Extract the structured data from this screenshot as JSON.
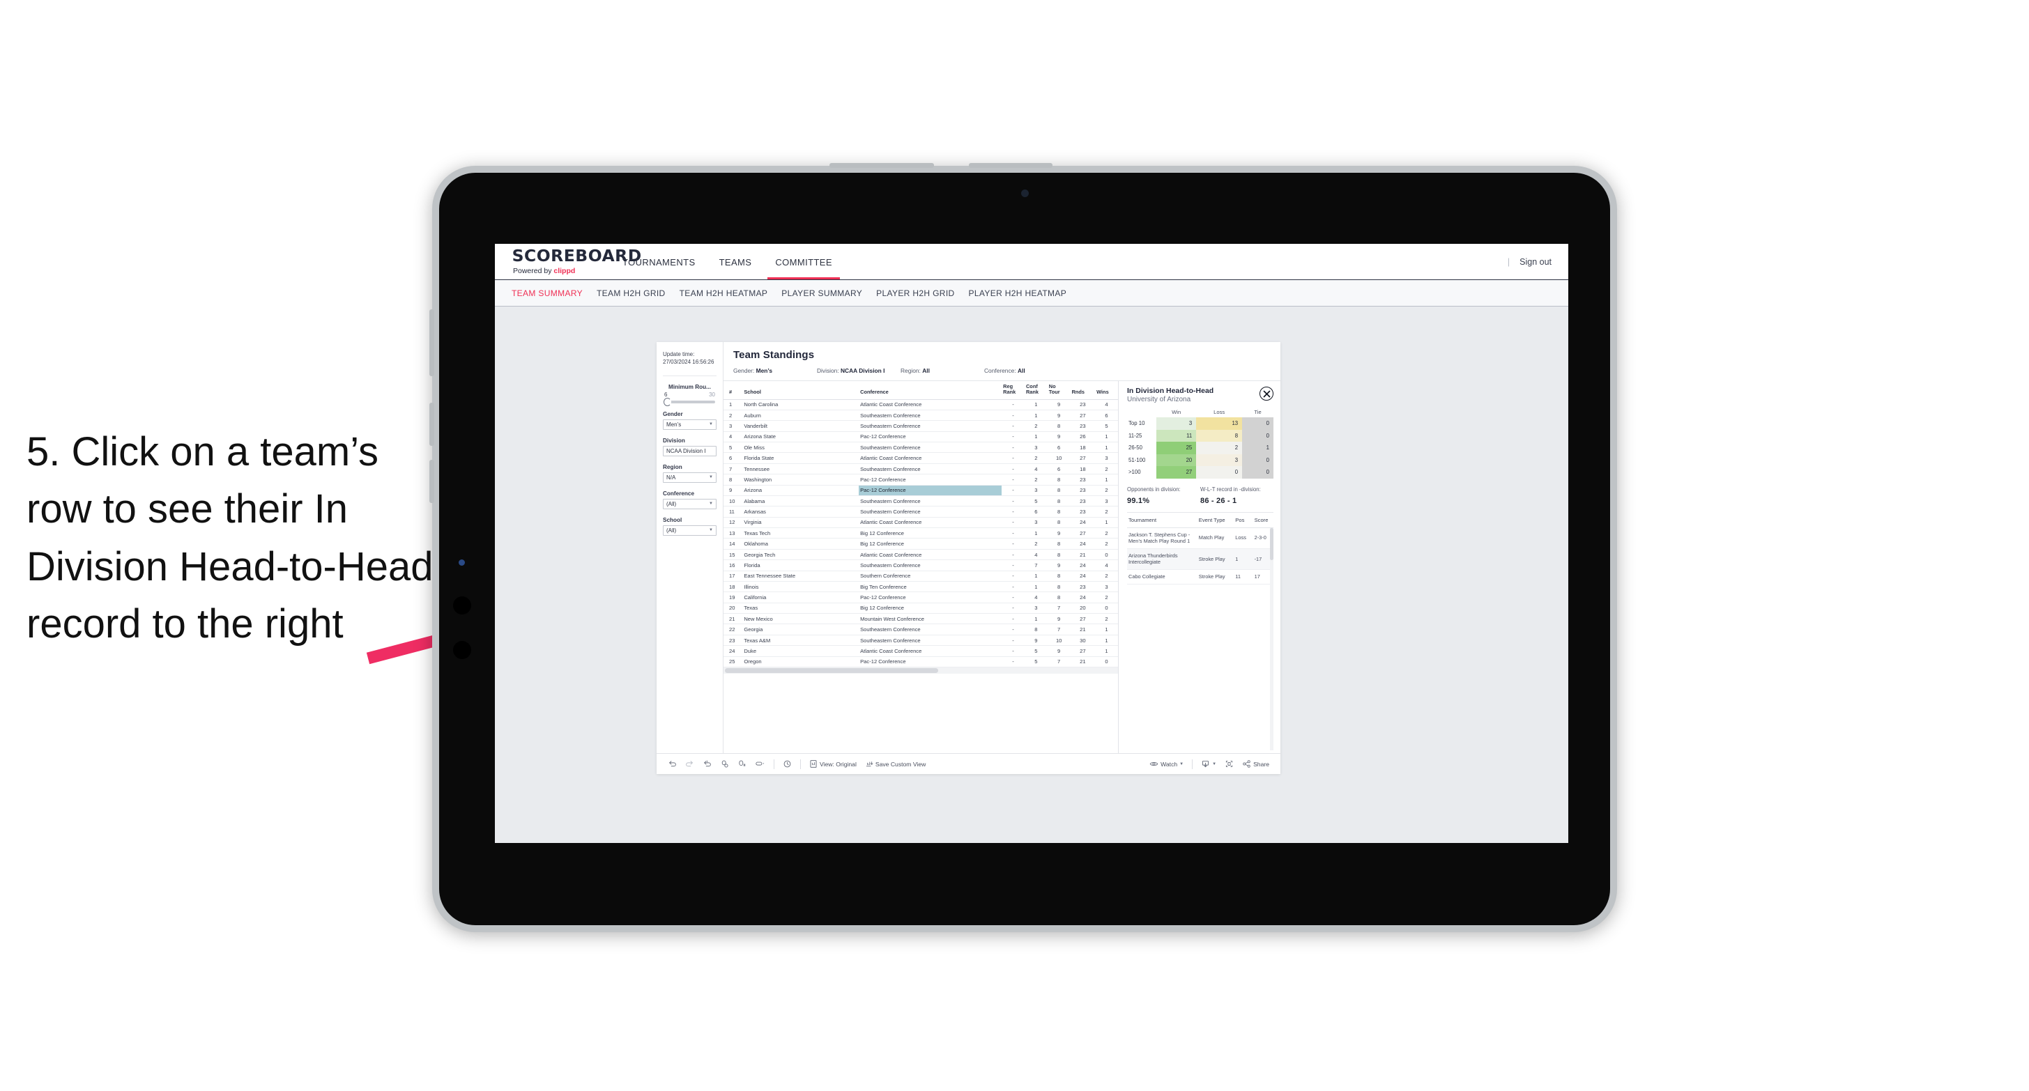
{
  "annotation": {
    "text": "5. Click on a team’s row to see their In Division Head-to-Head record to the right",
    "arrow_color": "#ef2d63"
  },
  "app": {
    "logo_main": "SCOREBOARD",
    "logo_sub_prefix": "Powered by ",
    "logo_sub_brand": "clippd",
    "top_nav": [
      {
        "label": "TOURNAMENTS",
        "active": false
      },
      {
        "label": "TEAMS",
        "active": false
      },
      {
        "label": "COMMITTEE",
        "active": true
      }
    ],
    "sign_out": "Sign out",
    "divider": "|",
    "sub_nav": [
      {
        "label": "TEAM SUMMARY",
        "active": true
      },
      {
        "label": "TEAM H2H GRID",
        "active": false
      },
      {
        "label": "TEAM H2H HEATMAP",
        "active": false
      },
      {
        "label": "PLAYER SUMMARY",
        "active": false
      },
      {
        "label": "PLAYER H2H GRID",
        "active": false
      },
      {
        "label": "PLAYER H2H HEATMAP",
        "active": false
      }
    ],
    "accent_color": "#ef2f54"
  },
  "filters": {
    "update_time_label": "Update time:",
    "update_time_value": "27/03/2024 16:56:26",
    "slider": {
      "title": "Minimum Rou...",
      "min": "6",
      "max": "30"
    },
    "groups": [
      {
        "label": "Gender",
        "value": "Men’s"
      },
      {
        "label": "Division",
        "value": "NCAA Division I"
      },
      {
        "label": "Region",
        "value": "N/A"
      },
      {
        "label": "Conference",
        "value": "(All)"
      },
      {
        "label": "School",
        "value": "(All)"
      }
    ]
  },
  "standings": {
    "title": "Team Standings",
    "meta": [
      {
        "label": "Gender:",
        "value": "Men’s"
      },
      {
        "label": "Division:",
        "value": "NCAA Division I"
      },
      {
        "label": "Region:",
        "value": "All"
      },
      {
        "label": "Conference:",
        "value": "All"
      }
    ],
    "columns": [
      "#",
      "School",
      "Conference",
      "Reg Rank",
      "Conf Rank",
      "No Tour",
      "Rnds",
      "Wins"
    ],
    "column_lines": [
      [
        "#",
        ""
      ],
      [
        "School",
        ""
      ],
      [
        "Conference",
        ""
      ],
      [
        "Reg",
        "Rank"
      ],
      [
        "Conf",
        "Rank"
      ],
      [
        "No",
        "Tour"
      ],
      [
        "",
        "Rnds"
      ],
      [
        "",
        "Wins"
      ]
    ],
    "selected_row_index": 8,
    "rows": [
      {
        "rank": "1",
        "school": "North Carolina",
        "conference": "Atlantic Coast Conference",
        "reg_rank": "-",
        "conf_rank": "1",
        "no_tour": "9",
        "rnds": "23",
        "wins": "4"
      },
      {
        "rank": "2",
        "school": "Auburn",
        "conference": "Southeastern Conference",
        "reg_rank": "-",
        "conf_rank": "1",
        "no_tour": "9",
        "rnds": "27",
        "wins": "6"
      },
      {
        "rank": "3",
        "school": "Vanderbilt",
        "conference": "Southeastern Conference",
        "reg_rank": "-",
        "conf_rank": "2",
        "no_tour": "8",
        "rnds": "23",
        "wins": "5"
      },
      {
        "rank": "4",
        "school": "Arizona State",
        "conference": "Pac-12 Conference",
        "reg_rank": "-",
        "conf_rank": "1",
        "no_tour": "9",
        "rnds": "26",
        "wins": "1"
      },
      {
        "rank": "5",
        "school": "Ole Miss",
        "conference": "Southeastern Conference",
        "reg_rank": "-",
        "conf_rank": "3",
        "no_tour": "6",
        "rnds": "18",
        "wins": "1"
      },
      {
        "rank": "6",
        "school": "Florida State",
        "conference": "Atlantic Coast Conference",
        "reg_rank": "-",
        "conf_rank": "2",
        "no_tour": "10",
        "rnds": "27",
        "wins": "3"
      },
      {
        "rank": "7",
        "school": "Tennessee",
        "conference": "Southeastern Conference",
        "reg_rank": "-",
        "conf_rank": "4",
        "no_tour": "6",
        "rnds": "18",
        "wins": "2"
      },
      {
        "rank": "8",
        "school": "Washington",
        "conference": "Pac-12 Conference",
        "reg_rank": "-",
        "conf_rank": "2",
        "no_tour": "8",
        "rnds": "23",
        "wins": "1"
      },
      {
        "rank": "9",
        "school": "Arizona",
        "conference": "Pac-12 Conference",
        "reg_rank": "-",
        "conf_rank": "3",
        "no_tour": "8",
        "rnds": "23",
        "wins": "2"
      },
      {
        "rank": "10",
        "school": "Alabama",
        "conference": "Southeastern Conference",
        "reg_rank": "-",
        "conf_rank": "5",
        "no_tour": "8",
        "rnds": "23",
        "wins": "3"
      },
      {
        "rank": "11",
        "school": "Arkansas",
        "conference": "Southeastern Conference",
        "reg_rank": "-",
        "conf_rank": "6",
        "no_tour": "8",
        "rnds": "23",
        "wins": "2"
      },
      {
        "rank": "12",
        "school": "Virginia",
        "conference": "Atlantic Coast Conference",
        "reg_rank": "-",
        "conf_rank": "3",
        "no_tour": "8",
        "rnds": "24",
        "wins": "1"
      },
      {
        "rank": "13",
        "school": "Texas Tech",
        "conference": "Big 12 Conference",
        "reg_rank": "-",
        "conf_rank": "1",
        "no_tour": "9",
        "rnds": "27",
        "wins": "2"
      },
      {
        "rank": "14",
        "school": "Oklahoma",
        "conference": "Big 12 Conference",
        "reg_rank": "-",
        "conf_rank": "2",
        "no_tour": "8",
        "rnds": "24",
        "wins": "2"
      },
      {
        "rank": "15",
        "school": "Georgia Tech",
        "conference": "Atlantic Coast Conference",
        "reg_rank": "-",
        "conf_rank": "4",
        "no_tour": "8",
        "rnds": "21",
        "wins": "0"
      },
      {
        "rank": "16",
        "school": "Florida",
        "conference": "Southeastern Conference",
        "reg_rank": "-",
        "conf_rank": "7",
        "no_tour": "9",
        "rnds": "24",
        "wins": "4"
      },
      {
        "rank": "17",
        "school": "East Tennessee State",
        "conference": "Southern Conference",
        "reg_rank": "-",
        "conf_rank": "1",
        "no_tour": "8",
        "rnds": "24",
        "wins": "2"
      },
      {
        "rank": "18",
        "school": "Illinois",
        "conference": "Big Ten Conference",
        "reg_rank": "-",
        "conf_rank": "1",
        "no_tour": "8",
        "rnds": "23",
        "wins": "3"
      },
      {
        "rank": "19",
        "school": "California",
        "conference": "Pac-12 Conference",
        "reg_rank": "-",
        "conf_rank": "4",
        "no_tour": "8",
        "rnds": "24",
        "wins": "2"
      },
      {
        "rank": "20",
        "school": "Texas",
        "conference": "Big 12 Conference",
        "reg_rank": "-",
        "conf_rank": "3",
        "no_tour": "7",
        "rnds": "20",
        "wins": "0"
      },
      {
        "rank": "21",
        "school": "New Mexico",
        "conference": "Mountain West Conference",
        "reg_rank": "-",
        "conf_rank": "1",
        "no_tour": "9",
        "rnds": "27",
        "wins": "2"
      },
      {
        "rank": "22",
        "school": "Georgia",
        "conference": "Southeastern Conference",
        "reg_rank": "-",
        "conf_rank": "8",
        "no_tour": "7",
        "rnds": "21",
        "wins": "1"
      },
      {
        "rank": "23",
        "school": "Texas A&M",
        "conference": "Southeastern Conference",
        "reg_rank": "-",
        "conf_rank": "9",
        "no_tour": "10",
        "rnds": "30",
        "wins": "1"
      },
      {
        "rank": "24",
        "school": "Duke",
        "conference": "Atlantic Coast Conference",
        "reg_rank": "-",
        "conf_rank": "5",
        "no_tour": "9",
        "rnds": "27",
        "wins": "1"
      },
      {
        "rank": "25",
        "school": "Oregon",
        "conference": "Pac-12 Conference",
        "reg_rank": "-",
        "conf_rank": "5",
        "no_tour": "7",
        "rnds": "21",
        "wins": "0"
      }
    ]
  },
  "h2h": {
    "title": "In Division Head-to-Head",
    "subtitle": "University of Arizona",
    "close_icon": "close-icon",
    "columns": [
      "Win",
      "Loss",
      "Tie"
    ],
    "rows": [
      {
        "band": "Top 10",
        "win": "3",
        "loss": "13",
        "tie": "0",
        "win_color": "#e3efe0",
        "loss_color": "#f2e2a0",
        "tie_color": "#d2d2d2"
      },
      {
        "band": "11-25",
        "win": "11",
        "loss": "8",
        "tie": "0",
        "win_color": "#cce6bd",
        "loss_color": "#f4ecc5",
        "tie_color": "#d2d2d2"
      },
      {
        "band": "26-50",
        "win": "25",
        "loss": "2",
        "tie": "1",
        "win_color": "#8fce77",
        "loss_color": "#f2f2ee",
        "tie_color": "#d2d2d2"
      },
      {
        "band": "51-100",
        "win": "20",
        "loss": "3",
        "tie": "0",
        "win_color": "#a3d68e",
        "loss_color": "#f4efe2",
        "tie_color": "#d2d2d2"
      },
      {
        "band": ">100",
        "win": "27",
        "loss": "0",
        "tie": "0",
        "win_color": "#92cf7a",
        "loss_color": "#f2f2ee",
        "tie_color": "#d2d2d2"
      }
    ],
    "stats": [
      {
        "label": "Opponents in division:",
        "value": "99.1%"
      },
      {
        "label": "W-L-T record in -division:",
        "value": "86 - 26 - 1"
      }
    ],
    "tournament_columns": [
      "Tournament",
      "Event Type",
      "Pos",
      "Score"
    ],
    "tournaments": [
      {
        "name": "Jackson T. Stephens Cup - Men’s Match Play Round 1",
        "event_type": "Match Play",
        "pos": "Loss",
        "score": "2-3-0"
      },
      {
        "name": "Arizona Thunderbirds Intercollegiate",
        "event_type": "Stroke Play",
        "pos": "1",
        "score": "-17"
      },
      {
        "name": "Cabo Collegiate",
        "event_type": "Stroke Play",
        "pos": "11",
        "score": "17"
      }
    ]
  },
  "toolbar": {
    "items": [
      {
        "name": "undo-icon",
        "label": "",
        "icon": "undo"
      },
      {
        "name": "redo-icon",
        "label": "",
        "icon": "redo"
      },
      {
        "name": "revert-icon",
        "label": "",
        "icon": "revert"
      },
      {
        "name": "refresh-data-icon",
        "label": "",
        "icon": "refresh"
      },
      {
        "name": "pause-updates-icon",
        "label": "",
        "icon": "pause"
      },
      {
        "name": "highlight-icon",
        "label": "",
        "icon": "highlight"
      }
    ],
    "view_label": "View: Original",
    "save_label": "Save Custom View",
    "watch_label": "Watch",
    "share_label": "Share",
    "download_icon": "download-icon",
    "fullscreen_icon": "fullscreen-icon",
    "share_icon": "share-icon",
    "view_icon": "view-original-icon",
    "save_icon": "save-view-icon",
    "watch_icon": "eye-icon"
  }
}
